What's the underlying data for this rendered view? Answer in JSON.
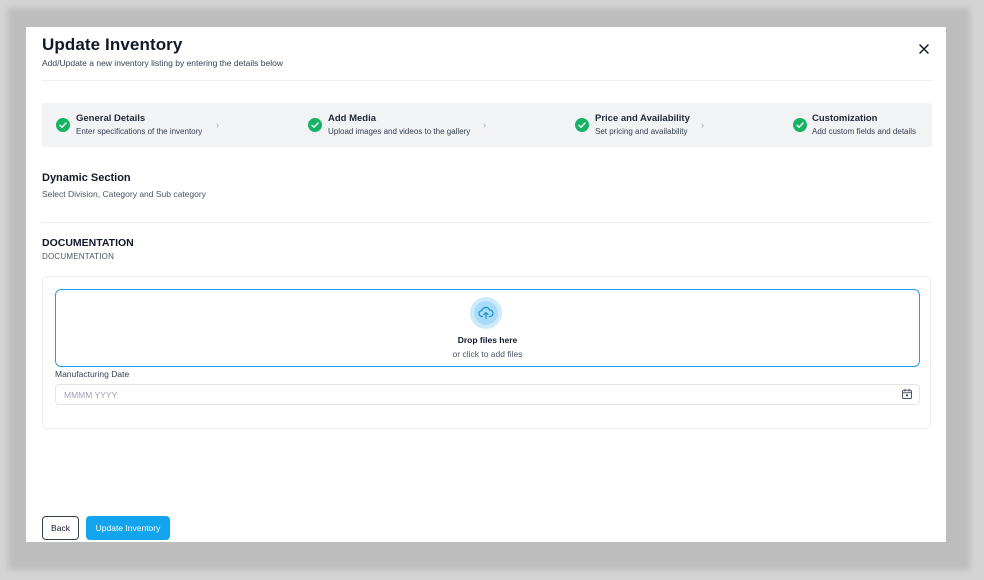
{
  "modal": {
    "title": "Update Inventory",
    "subtitle": "Add/Update a new inventory listing by entering the details below"
  },
  "steps": [
    {
      "title": "General Details",
      "description": "Enter specifications of the inventory",
      "status": "complete"
    },
    {
      "title": "Add Media",
      "description": "Upload images and videos to the gallery",
      "status": "complete"
    },
    {
      "title": "Price and Availability",
      "description": "Set pricing and availability",
      "status": "complete"
    },
    {
      "title": "Customization",
      "description": "Add custom fields and details",
      "status": "complete"
    }
  ],
  "dynamic_section": {
    "title": "Dynamic Section",
    "subtitle": "Select Division, Category and Sub category"
  },
  "documentation": {
    "title": "DOCUMENTATION",
    "subtitle": "DOCUMENTATION",
    "dropzone": {
      "title": "Drop files here",
      "subtitle": "or click to add files",
      "icon": "cloud-upload-icon"
    },
    "manufacturing_date": {
      "label": "Manufacturing Date",
      "placeholder": "MMMM YYYY",
      "value": ""
    }
  },
  "footer": {
    "back_label": "Back",
    "update_label": "Update Inventory"
  },
  "colors": {
    "accent": "#12a4ec",
    "success": "#16b364",
    "stepper_bg": "#f2f3f5"
  }
}
